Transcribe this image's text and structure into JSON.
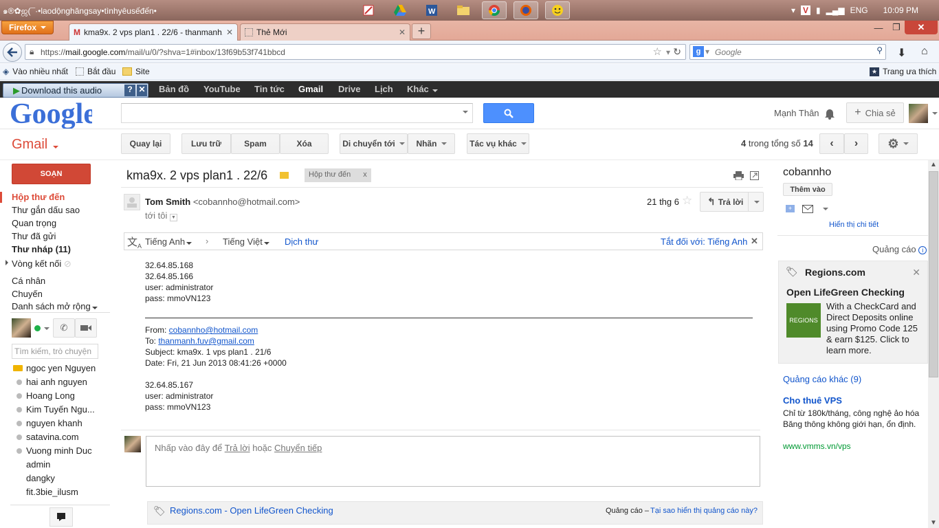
{
  "taskbar": {
    "title": "๑®✿ஜ(¯·•laodộnghăngsay•tìnhyêusếđến•",
    "lang": "ENG",
    "time": "10:09 PM"
  },
  "browser": {
    "menu_label": "Firefox",
    "tabs": [
      {
        "label": "kma9x. 2 vps plan1 . 22/6 - thanmanh..."
      },
      {
        "label": "Thẻ Mới"
      }
    ],
    "url_prefix": "https://",
    "url_domain": "mail.google.com",
    "url_rest": "/mail/u/0/?shva=1#inbox/13f69b53f741bbcd",
    "search_placeholder": "Google",
    "bookmarks": [
      "Vào nhiều nhất",
      "Bắt đầu",
      "Site"
    ],
    "bookmarks_right": "Trang ưa thích"
  },
  "download_audio": "Download this audio",
  "gbar": {
    "items": [
      "Bản đồ",
      "YouTube",
      "Tin tức",
      "Gmail",
      "Drive",
      "Lịch",
      "Khác"
    ],
    "active": "Gmail"
  },
  "header": {
    "logo_text": "Google",
    "user_name": "Mạnh Thân",
    "share_label": "Chia sẻ"
  },
  "toolbar": {
    "gmail_label": "Gmail",
    "back": "Quay lại",
    "archive": "Lưu trữ",
    "spam": "Spam",
    "delete": "Xóa",
    "move": "Di chuyển tới",
    "labels": "Nhãn",
    "more": "Tác vụ khác",
    "pager_pos": "4",
    "pager_mid": "trong tổng số",
    "pager_total": "14"
  },
  "nav": {
    "compose": "SOẠN",
    "items": [
      "Hộp thư đến",
      "Thư gắn dấu sao",
      "Quan trọng",
      "Thư đã gửi",
      "Thư nháp (11)",
      "Vòng kết nối",
      "Cá nhân",
      "Chuyến",
      "Danh sách mở rộng"
    ]
  },
  "chat": {
    "search_placeholder": "Tìm kiếm, trò chuyện",
    "contacts": [
      "ngoc yen Nguyen",
      "hai anh nguyen",
      "Hoang Long",
      "Kim Tuyến Ngu...",
      "nguyen khanh",
      "satavina.com",
      "Vuong minh Duc",
      "admin",
      "dangky",
      "fit.3bie_ilusm"
    ]
  },
  "message": {
    "subject": "kma9x. 2 vps plan1 . 22/6",
    "label": "Hộp thư đến",
    "sender_name": "Tom Smith",
    "sender_email": "<cobannho@hotmail.com>",
    "to": "tới tôi",
    "date": "21 thg 6",
    "reply": "Trả lời",
    "translate_from": "Tiếng Anh",
    "translate_to": "Tiếng Việt",
    "translate_action": "Dịch thư",
    "translate_off": "Tắt đối với: Tiếng Anh",
    "body_top": "32.64.85.168\n32.64.85.166\nuser: administrator\npass: mmoVN123",
    "fwd_from_label": "From: ",
    "fwd_from": "cobannho@hotmail.com",
    "fwd_to_label": "To: ",
    "fwd_to": "thanmanh.fuv@gmail.com",
    "fwd_subject": "Subject: kma9x. 1 vps plan1 . 21/6",
    "fwd_date": "Date: Fri, 21 Jun 2013 08:41:26 +0000",
    "body_bottom": "32.64.85.167\nuser: administrator\npass: mmoVN123",
    "reply_hint_1": "Nhấp vào đây để ",
    "reply_hint_link1": "Trả lời",
    "reply_hint_2": " hoặc ",
    "reply_hint_link2": "Chuyển tiếp"
  },
  "bottom_ad": {
    "link": "Regions.com - Open LifeGreen Checking",
    "label": "Quảng cáo –",
    "why": "Tại sao hiển thị quảng cáo này?"
  },
  "right": {
    "contact_name": "cobannho",
    "add_button": "Thêm vào",
    "detail_link": "Hiển thị chi tiết",
    "ads_label": "Quảng cáo",
    "ad_domain": "Regions.com",
    "ad_heading": "Open LifeGreen Checking",
    "ad_logo": "REGIONS",
    "ad_text": "With a CheckCard and Direct Deposits online using Promo Code 125 & earn $125. Click to learn more.",
    "more_ads": "Quảng cáo khác (9)",
    "vps_title": "Cho thuê VPS",
    "vps_text": "Chỉ từ 180k/tháng, công nghệ ảo hóa Băng thông không giới hạn, ổn định.",
    "vps_url": "www.vmms.vn/vps"
  },
  "colors": {
    "gmail_red": "#dd4b39",
    "search_blue": "#4d90fe",
    "link": "#1155cc",
    "compose": "#d14836"
  }
}
